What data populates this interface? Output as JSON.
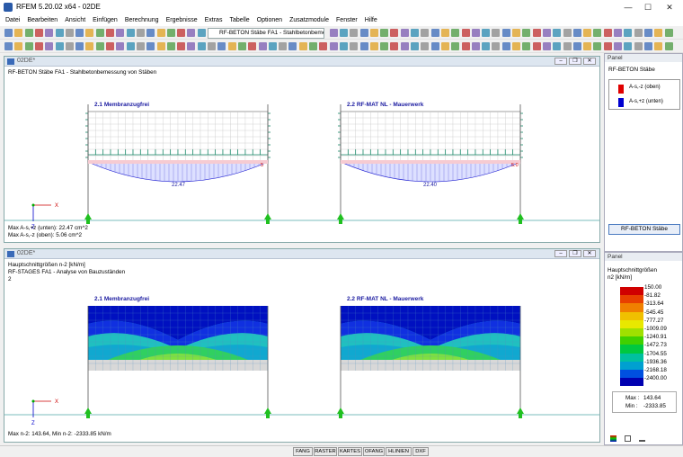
{
  "window": {
    "title": "RFEM 5.20.02 x64 - 02DE",
    "min": "—",
    "max": "☐",
    "close": "✕"
  },
  "menu": [
    "Datei",
    "Bearbeiten",
    "Ansicht",
    "Einfügen",
    "Berechnung",
    "Ergebnisse",
    "Extras",
    "Tabelle",
    "Optionen",
    "Zusatzmodule",
    "Fenster",
    "Hilfe"
  ],
  "toolbar": {
    "combo_value": "RF-BETON Stäbe FA1 - Stahlbetonbemes"
  },
  "top_view": {
    "tab_title": "02DE*",
    "info_line1": "RF-BETON Stäbe FA1 - Stahlbetonbemessung von Stäben",
    "wall1_label": "2.1 Membranzugfrei",
    "wall2_label": "2.2 RF-MAT NL - Mauerwerk",
    "value1": "22.47",
    "value2": "22.40",
    "small1": "5",
    "small2": "5.0",
    "axis_x": "X",
    "axis_z": "Z",
    "max_line1": "Max A-s,+z (unten): 22.47 cm^2",
    "max_line2": "Max A-s,-z (oben): 5.06 cm^2"
  },
  "bottom_view": {
    "tab_title": "02DE*",
    "info_line1": "Hauptschnittgrößen n-2 [kN/m]",
    "info_line2": "RF-STAGES FA1 - Analyse von Bauzuständen",
    "info_line3": "2",
    "wall1_label": "2.1 Membranzugfrei",
    "wall2_label": "2.2 RF-MAT NL - Mauerwerk",
    "axis_x": "X",
    "axis_z": "Z",
    "max_line": "Max n-2: 143.64, Min n-2: -2333.85 kN/m"
  },
  "panel1": {
    "header": "Panel",
    "title": "RF-BETON Stäbe",
    "legend": [
      {
        "label": "A-s,-z (oben)",
        "color": "#e00000"
      },
      {
        "label": "A-s,+z (unten)",
        "color": "#0000d0"
      }
    ],
    "button": "RF-BETON Stäbe"
  },
  "panel2": {
    "header": "Panel",
    "title": "Hauptschnittgrößen",
    "unit": "n2 [kN/m]",
    "scale": [
      {
        "value": "150.00",
        "color": "#d00000"
      },
      {
        "value": "-81.82",
        "color": "#e84000"
      },
      {
        "value": "-313.64",
        "color": "#f08000"
      },
      {
        "value": "-545.45",
        "color": "#f0c000"
      },
      {
        "value": "-777.27",
        "color": "#e8e800"
      },
      {
        "value": "-1009.09",
        "color": "#a0e000"
      },
      {
        "value": "-1240.91",
        "color": "#40d000"
      },
      {
        "value": "-1472.73",
        "color": "#00c840"
      },
      {
        "value": "-1704.55",
        "color": "#00c0a0"
      },
      {
        "value": "-1936.36",
        "color": "#00a0d0"
      },
      {
        "value": "-2168.18",
        "color": "#0050e0"
      },
      {
        "value": "-2400.00",
        "color": "#0000b0"
      }
    ],
    "max_label": "Max :",
    "max_value": "143.64",
    "min_label": "Min :",
    "min_value": "-2333.85"
  },
  "statusbar": [
    "FANG",
    "RASTER",
    "KARTES",
    "OFANG",
    "HLINIEN",
    "DXF"
  ]
}
